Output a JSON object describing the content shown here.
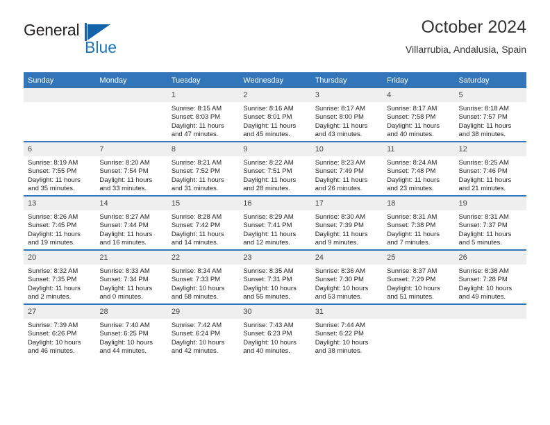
{
  "brand": {
    "name_top": "General",
    "name_bottom": "Blue",
    "icon": "sail-triangle-icon",
    "color_dark": "#231f20",
    "color_blue": "#1b75bb"
  },
  "header": {
    "title": "October 2024",
    "subtitle": "Villarrubia, Andalusia, Spain"
  },
  "theme": {
    "header_blue": "#3275b8",
    "daynum_gray": "#efefef"
  },
  "calendar": {
    "weekday_headers": [
      "Sunday",
      "Monday",
      "Tuesday",
      "Wednesday",
      "Thursday",
      "Friday",
      "Saturday"
    ],
    "weeks": [
      [
        {
          "day": "",
          "empty": true,
          "sunrise": "",
          "sunset": "",
          "daylight1": "",
          "daylight2": ""
        },
        {
          "day": "",
          "empty": true,
          "sunrise": "",
          "sunset": "",
          "daylight1": "",
          "daylight2": ""
        },
        {
          "day": "1",
          "sunrise": "Sunrise: 8:15 AM",
          "sunset": "Sunset: 8:03 PM",
          "daylight1": "Daylight: 11 hours",
          "daylight2": "and 47 minutes."
        },
        {
          "day": "2",
          "sunrise": "Sunrise: 8:16 AM",
          "sunset": "Sunset: 8:01 PM",
          "daylight1": "Daylight: 11 hours",
          "daylight2": "and 45 minutes."
        },
        {
          "day": "3",
          "sunrise": "Sunrise: 8:17 AM",
          "sunset": "Sunset: 8:00 PM",
          "daylight1": "Daylight: 11 hours",
          "daylight2": "and 43 minutes."
        },
        {
          "day": "4",
          "sunrise": "Sunrise: 8:17 AM",
          "sunset": "Sunset: 7:58 PM",
          "daylight1": "Daylight: 11 hours",
          "daylight2": "and 40 minutes."
        },
        {
          "day": "5",
          "sunrise": "Sunrise: 8:18 AM",
          "sunset": "Sunset: 7:57 PM",
          "daylight1": "Daylight: 11 hours",
          "daylight2": "and 38 minutes."
        }
      ],
      [
        {
          "day": "6",
          "sunrise": "Sunrise: 8:19 AM",
          "sunset": "Sunset: 7:55 PM",
          "daylight1": "Daylight: 11 hours",
          "daylight2": "and 35 minutes."
        },
        {
          "day": "7",
          "sunrise": "Sunrise: 8:20 AM",
          "sunset": "Sunset: 7:54 PM",
          "daylight1": "Daylight: 11 hours",
          "daylight2": "and 33 minutes."
        },
        {
          "day": "8",
          "sunrise": "Sunrise: 8:21 AM",
          "sunset": "Sunset: 7:52 PM",
          "daylight1": "Daylight: 11 hours",
          "daylight2": "and 31 minutes."
        },
        {
          "day": "9",
          "sunrise": "Sunrise: 8:22 AM",
          "sunset": "Sunset: 7:51 PM",
          "daylight1": "Daylight: 11 hours",
          "daylight2": "and 28 minutes."
        },
        {
          "day": "10",
          "sunrise": "Sunrise: 8:23 AM",
          "sunset": "Sunset: 7:49 PM",
          "daylight1": "Daylight: 11 hours",
          "daylight2": "and 26 minutes."
        },
        {
          "day": "11",
          "sunrise": "Sunrise: 8:24 AM",
          "sunset": "Sunset: 7:48 PM",
          "daylight1": "Daylight: 11 hours",
          "daylight2": "and 23 minutes."
        },
        {
          "day": "12",
          "sunrise": "Sunrise: 8:25 AM",
          "sunset": "Sunset: 7:46 PM",
          "daylight1": "Daylight: 11 hours",
          "daylight2": "and 21 minutes."
        }
      ],
      [
        {
          "day": "13",
          "sunrise": "Sunrise: 8:26 AM",
          "sunset": "Sunset: 7:45 PM",
          "daylight1": "Daylight: 11 hours",
          "daylight2": "and 19 minutes."
        },
        {
          "day": "14",
          "sunrise": "Sunrise: 8:27 AM",
          "sunset": "Sunset: 7:44 PM",
          "daylight1": "Daylight: 11 hours",
          "daylight2": "and 16 minutes."
        },
        {
          "day": "15",
          "sunrise": "Sunrise: 8:28 AM",
          "sunset": "Sunset: 7:42 PM",
          "daylight1": "Daylight: 11 hours",
          "daylight2": "and 14 minutes."
        },
        {
          "day": "16",
          "sunrise": "Sunrise: 8:29 AM",
          "sunset": "Sunset: 7:41 PM",
          "daylight1": "Daylight: 11 hours",
          "daylight2": "and 12 minutes."
        },
        {
          "day": "17",
          "sunrise": "Sunrise: 8:30 AM",
          "sunset": "Sunset: 7:39 PM",
          "daylight1": "Daylight: 11 hours",
          "daylight2": "and 9 minutes."
        },
        {
          "day": "18",
          "sunrise": "Sunrise: 8:31 AM",
          "sunset": "Sunset: 7:38 PM",
          "daylight1": "Daylight: 11 hours",
          "daylight2": "and 7 minutes."
        },
        {
          "day": "19",
          "sunrise": "Sunrise: 8:31 AM",
          "sunset": "Sunset: 7:37 PM",
          "daylight1": "Daylight: 11 hours",
          "daylight2": "and 5 minutes."
        }
      ],
      [
        {
          "day": "20",
          "sunrise": "Sunrise: 8:32 AM",
          "sunset": "Sunset: 7:35 PM",
          "daylight1": "Daylight: 11 hours",
          "daylight2": "and 2 minutes."
        },
        {
          "day": "21",
          "sunrise": "Sunrise: 8:33 AM",
          "sunset": "Sunset: 7:34 PM",
          "daylight1": "Daylight: 11 hours",
          "daylight2": "and 0 minutes."
        },
        {
          "day": "22",
          "sunrise": "Sunrise: 8:34 AM",
          "sunset": "Sunset: 7:33 PM",
          "daylight1": "Daylight: 10 hours",
          "daylight2": "and 58 minutes."
        },
        {
          "day": "23",
          "sunrise": "Sunrise: 8:35 AM",
          "sunset": "Sunset: 7:31 PM",
          "daylight1": "Daylight: 10 hours",
          "daylight2": "and 55 minutes."
        },
        {
          "day": "24",
          "sunrise": "Sunrise: 8:36 AM",
          "sunset": "Sunset: 7:30 PM",
          "daylight1": "Daylight: 10 hours",
          "daylight2": "and 53 minutes."
        },
        {
          "day": "25",
          "sunrise": "Sunrise: 8:37 AM",
          "sunset": "Sunset: 7:29 PM",
          "daylight1": "Daylight: 10 hours",
          "daylight2": "and 51 minutes."
        },
        {
          "day": "26",
          "sunrise": "Sunrise: 8:38 AM",
          "sunset": "Sunset: 7:28 PM",
          "daylight1": "Daylight: 10 hours",
          "daylight2": "and 49 minutes."
        }
      ],
      [
        {
          "day": "27",
          "sunrise": "Sunrise: 7:39 AM",
          "sunset": "Sunset: 6:26 PM",
          "daylight1": "Daylight: 10 hours",
          "daylight2": "and 46 minutes."
        },
        {
          "day": "28",
          "sunrise": "Sunrise: 7:40 AM",
          "sunset": "Sunset: 6:25 PM",
          "daylight1": "Daylight: 10 hours",
          "daylight2": "and 44 minutes."
        },
        {
          "day": "29",
          "sunrise": "Sunrise: 7:42 AM",
          "sunset": "Sunset: 6:24 PM",
          "daylight1": "Daylight: 10 hours",
          "daylight2": "and 42 minutes."
        },
        {
          "day": "30",
          "sunrise": "Sunrise: 7:43 AM",
          "sunset": "Sunset: 6:23 PM",
          "daylight1": "Daylight: 10 hours",
          "daylight2": "and 40 minutes."
        },
        {
          "day": "31",
          "sunrise": "Sunrise: 7:44 AM",
          "sunset": "Sunset: 6:22 PM",
          "daylight1": "Daylight: 10 hours",
          "daylight2": "and 38 minutes."
        },
        {
          "day": "",
          "empty": true,
          "sunrise": "",
          "sunset": "",
          "daylight1": "",
          "daylight2": ""
        },
        {
          "day": "",
          "empty": true,
          "sunrise": "",
          "sunset": "",
          "daylight1": "",
          "daylight2": ""
        }
      ]
    ]
  }
}
